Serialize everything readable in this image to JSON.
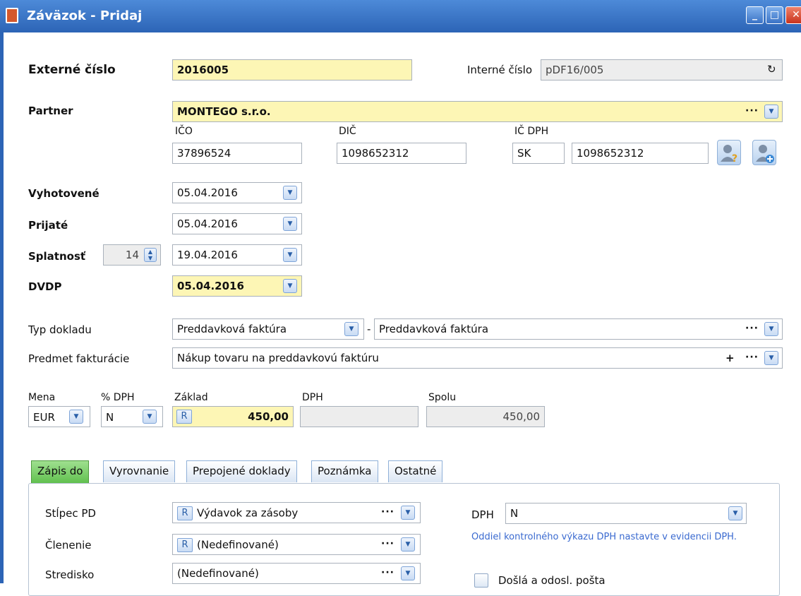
{
  "window": {
    "title": "Záväzok - Pridaj",
    "min": "_",
    "max": "□",
    "close": "✕"
  },
  "header": {
    "external_label": "Externé číslo",
    "external_value": "2016005",
    "internal_label": "Interné číslo",
    "internal_value": "pDF16/005",
    "internal_refresh": "↻"
  },
  "partner": {
    "label": "Partner",
    "value": "MONTEGO s.r.o.",
    "dots": "···",
    "ico_label": "IČO",
    "ico": "37896524",
    "dic_label": "DIČ",
    "dic": "1098652312",
    "icdph_label": "IČ DPH",
    "icdph_prefix": "SK",
    "icdph": "1098652312"
  },
  "dates": {
    "vyhotovene_label": "Vyhotovené",
    "vyhotovene": "05.04.2016",
    "prijate_label": "Prijaté",
    "prijate": "05.04.2016",
    "splatnost_label": "Splatnosť",
    "splatnost_days": "14",
    "splatnost": "19.04.2016",
    "dvdp_label": "DVDP",
    "dvdp": "05.04.2016"
  },
  "doc": {
    "typ_label": "Typ dokladu",
    "typ_value": "Preddavková faktúra",
    "typ_sep": "-",
    "typ_value2": "Preddavková faktúra",
    "predmet_label": "Predmet fakturácie",
    "predmet_value": "Nákup tovaru na preddavkovú faktúru",
    "plus": "+"
  },
  "amounts": {
    "mena_label": "Mena",
    "mena": "EUR",
    "dph_pct_label": "% DPH",
    "dph_pct": "N",
    "zaklad_label": "Základ",
    "r_badge": "R",
    "zaklad": "450,00",
    "dph_label": "DPH",
    "dph": "",
    "spolu_label": "Spolu",
    "spolu": "450,00"
  },
  "tabs": [
    "Zápis do",
    "Vyrovnanie",
    "Prepojené doklady",
    "Poznámka",
    "Ostatné"
  ],
  "panel": {
    "stlpec_label": "Stĺpec PD",
    "stlpec_value": "Výdavok za zásoby",
    "clenenie_label": "Členenie",
    "clenenie_value": "(Nedefinované)",
    "stredisko_label": "Stredisko",
    "stredisko_value": "(Nedefinované)",
    "dph_label": "DPH",
    "dph_value": "N",
    "note": "Oddiel kontrolného výkazu DPH nastavte v evidencii DPH.",
    "posta_label": "Došlá a odosl. pošta"
  }
}
